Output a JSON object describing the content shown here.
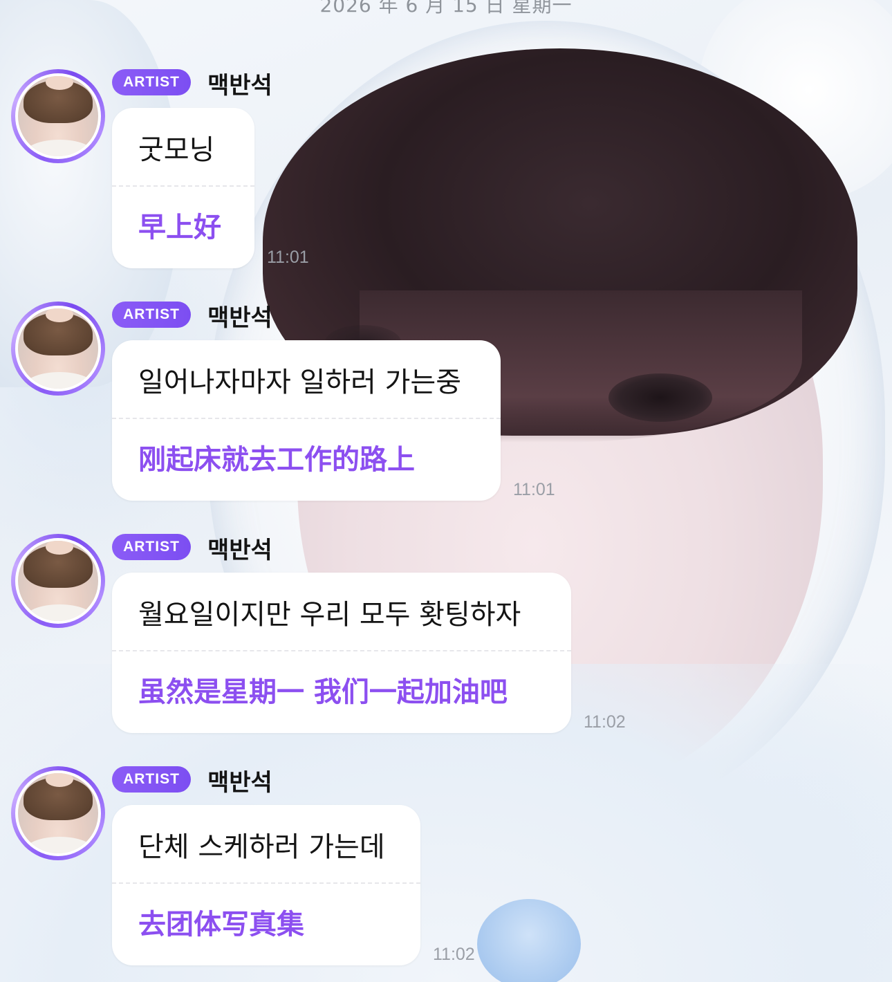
{
  "date_header": "2026 年 6 月 15 日 星期一",
  "messages": [
    {
      "badge": "ARTIST",
      "sender": "맥반석",
      "korean": "굿모닝",
      "chinese": "早上好",
      "time": "11:01"
    },
    {
      "badge": "ARTIST",
      "sender": "맥반석",
      "korean": "일어나자마자 일하러 가는중",
      "chinese": "刚起床就去工作的路上",
      "time": "11:01"
    },
    {
      "badge": "ARTIST",
      "sender": "맥반석",
      "korean": "월요일이지만 우리 모두 홧팅하자",
      "chinese": "虽然是星期一 我们一起加油吧",
      "time": "11:02"
    },
    {
      "badge": "ARTIST",
      "sender": "맥반석",
      "korean": "단체 스케하러 가는데",
      "chinese": "去团体写真集",
      "time": "11:02"
    }
  ],
  "colors": {
    "accent": "#8b5cf6",
    "translation_text": "#8c4ff0",
    "timestamp": "#9a9ea6"
  }
}
